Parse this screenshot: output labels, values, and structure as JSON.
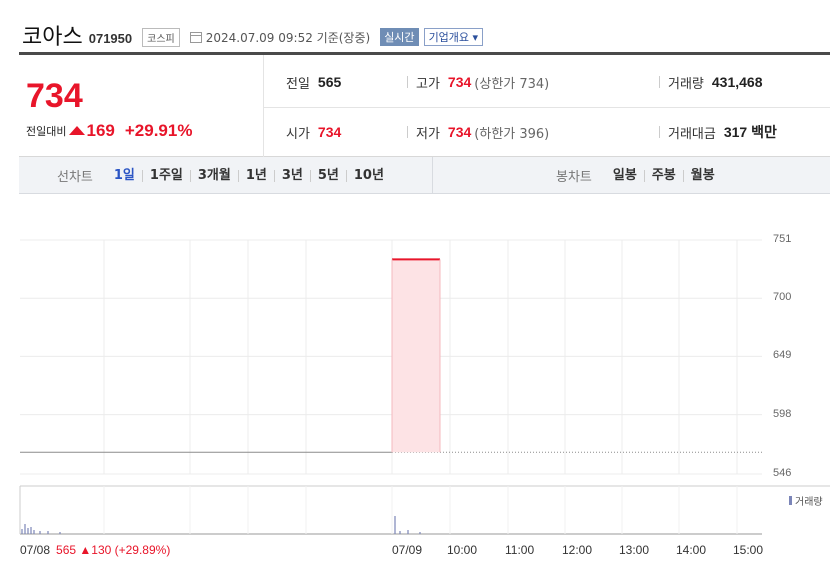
{
  "header": {
    "stock_name": "코아스",
    "stock_code": "071950",
    "market": "코스피",
    "datetime": "2024.07.09 09:52 기준(장중)",
    "realtime_label": "실시간",
    "overview_label": "기업개요 ▾"
  },
  "summary": {
    "price": "734",
    "change_label": "전일대비",
    "change_amount": "169",
    "change_percent": "+29.91%",
    "prev_close_label": "전일",
    "prev_close": "565",
    "open_label": "시가",
    "open": "734",
    "high_label": "고가",
    "high": "734",
    "upper_limit": "(상한가 734)",
    "low_label": "저가",
    "low": "734",
    "lower_limit": "(하한가 396)",
    "volume_label": "거래량",
    "volume": "431,468",
    "value_label": "거래대금",
    "value": "317 백만"
  },
  "tabs": {
    "line_label": "선차트",
    "line_periods": [
      "1일",
      "1주일",
      "3개월",
      "1년",
      "3년",
      "5년",
      "10년"
    ],
    "active_period": "1일",
    "candle_label": "봉차트",
    "candle_periods": [
      "일봉",
      "주봉",
      "월봉"
    ]
  },
  "chart_data": {
    "type": "area",
    "y_ticks": [
      "751",
      "700",
      "649",
      "598",
      "546"
    ],
    "ylim": [
      546,
      751
    ],
    "prev_close": 565,
    "x_ticks": [
      "07/09",
      "10:00",
      "11:00",
      "12:00",
      "13:00",
      "14:00",
      "15:00"
    ],
    "series": [
      {
        "values": [
          734,
          734,
          734,
          734,
          734,
          734,
          734,
          734,
          734
        ]
      }
    ],
    "volume_label": "거래량",
    "prev_day_date": "07/08",
    "prev_day_summary": "565 ▲130 (+29.89%)",
    "colors": {
      "up": "#e8152a",
      "area_fill": "#fde3e5",
      "volume": "#7b85b8"
    }
  }
}
